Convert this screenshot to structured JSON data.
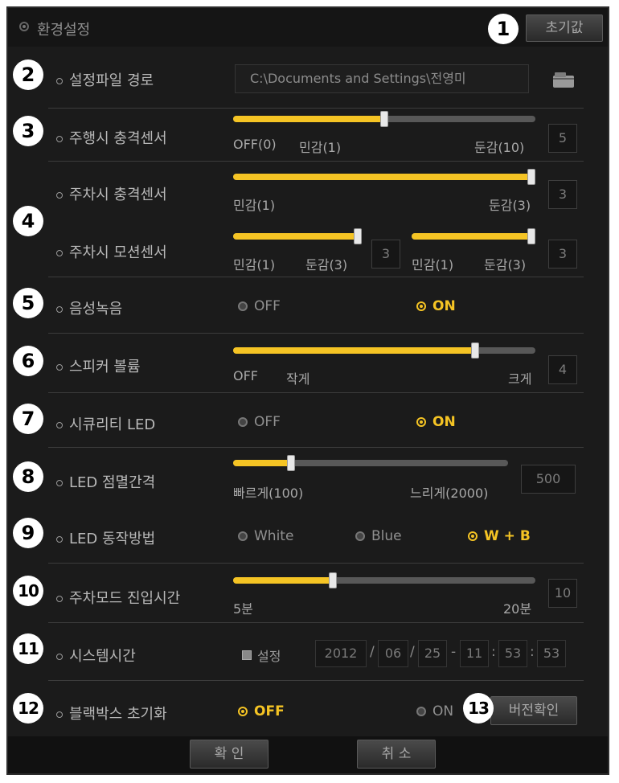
{
  "window": {
    "title": "환경설정",
    "reset_label": "초기값"
  },
  "badges": [
    "1",
    "2",
    "3",
    "4",
    "5",
    "6",
    "7",
    "8",
    "9",
    "10",
    "11",
    "12",
    "13"
  ],
  "config_path": {
    "label": "설정파일 경로",
    "value": "C:\\Documents and Settings\\전영미"
  },
  "drive_shock": {
    "label": "주행시 충격센서",
    "min_label": "OFF(0)",
    "mid_label": "민감(1)",
    "max_label": "둔감(10)",
    "value": "5",
    "level": 0.5
  },
  "park_shock": {
    "label": "주차시 충격센서",
    "min_label": "민감(1)",
    "max_label": "둔감(3)",
    "value": "3",
    "level": 1.0
  },
  "park_motion": {
    "label": "주차시 모션센서",
    "a": {
      "min_label": "민감(1)",
      "max_label": "둔감(3)",
      "value": "3",
      "level": 1.0
    },
    "b": {
      "min_label": "민감(1)",
      "max_label": "둔감(3)",
      "value": "3",
      "level": 1.0
    }
  },
  "voice_rec": {
    "label": "음성녹음",
    "off": "OFF",
    "on": "ON",
    "selected": "ON"
  },
  "speaker": {
    "label": "스피커 볼륨",
    "min_label": "OFF",
    "mid_label": "작게",
    "max_label": "크게",
    "value": "4",
    "level": 0.8
  },
  "security_led": {
    "label": "시큐리티 LED",
    "off": "OFF",
    "on": "ON",
    "selected": "ON"
  },
  "led_interval": {
    "label": "LED 점멸간격",
    "min_label": "빠르게(100)",
    "max_label": "느리게(2000)",
    "value": "500",
    "level": 0.21
  },
  "led_mode": {
    "label": "LED 동작방법",
    "opt1": "White",
    "opt2": "Blue",
    "opt3": "W + B",
    "selected": "W + B"
  },
  "park_entry": {
    "label": "주차모드 진입시간",
    "min_label": "5분",
    "max_label": "20분",
    "value": "10",
    "level": 0.33
  },
  "system_time": {
    "label": "시스템시간",
    "check_label": "설정",
    "year": "2012",
    "month": "06",
    "day": "25",
    "hour": "11",
    "minute": "53",
    "second": "53",
    "sep_date": "/",
    "sep_mid": "-",
    "sep_time": ":"
  },
  "blackbox_reset": {
    "label": "블랙박스 초기화",
    "off": "OFF",
    "on": "ON",
    "selected": "OFF",
    "version_label": "버전확인"
  },
  "footer": {
    "ok_label": "확 인",
    "cancel_label": "취 소"
  },
  "colors": {
    "accent": "#f5c424",
    "background": "#1b1b1b"
  },
  "icons": {
    "folder": "folder-icon",
    "settings": "settings-icon"
  }
}
